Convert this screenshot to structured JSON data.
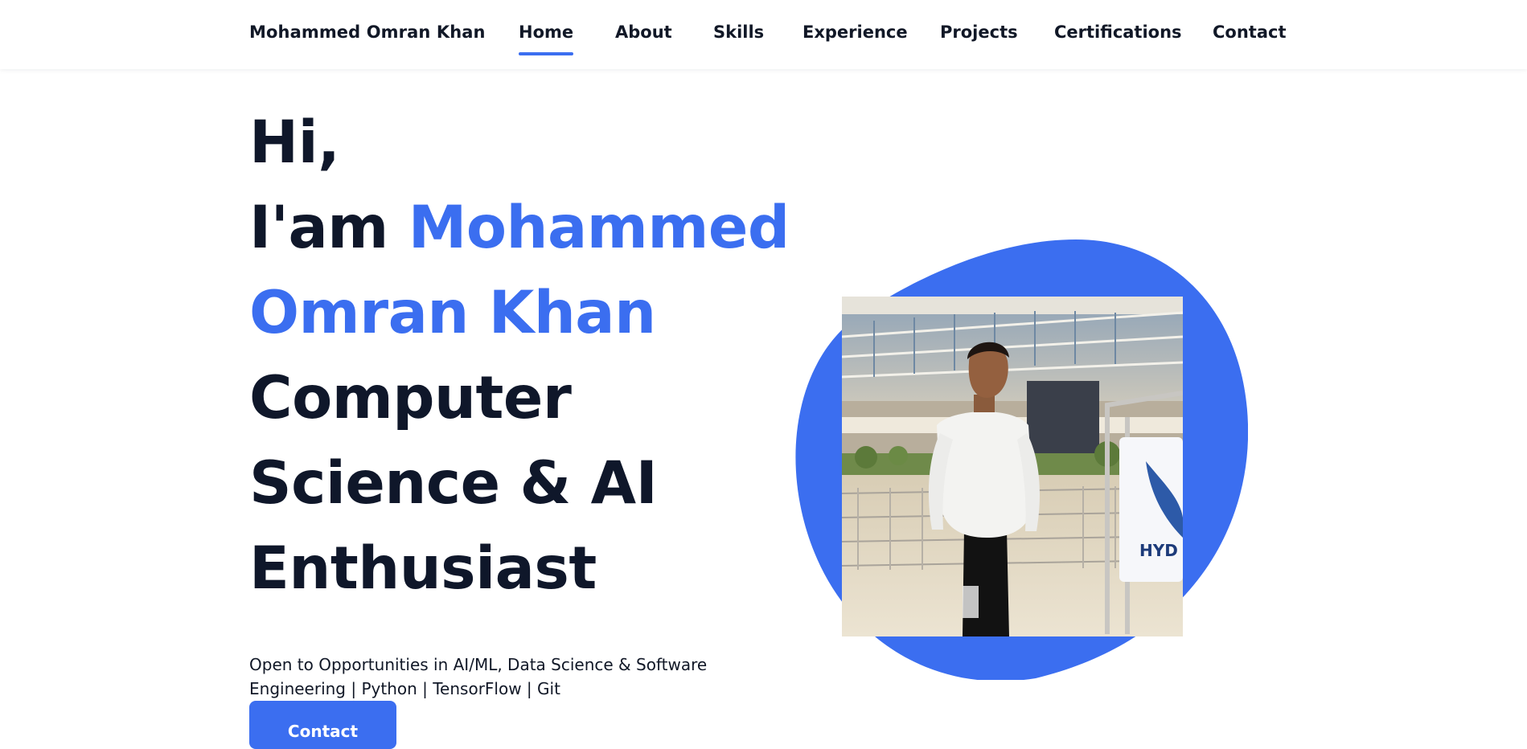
{
  "header": {
    "brand": "Mohammed Omran Khan",
    "nav": [
      {
        "label": "Home",
        "active": true
      },
      {
        "label": "About",
        "active": false
      },
      {
        "label": "Skills",
        "active": false
      },
      {
        "label": "Experience",
        "active": false
      },
      {
        "label": "Projects",
        "active": false
      },
      {
        "label": "Certifications",
        "active": false
      },
      {
        "label": "Contact",
        "active": false
      }
    ]
  },
  "hero": {
    "greeting": "Hi,",
    "intro_prefix": "I'am",
    "name_line1": "Mohammed",
    "name_line2": "Omran Khan",
    "title_line1": "Computer",
    "title_line2": "Science & AI",
    "title_line3": "Enthusiast",
    "tagline": "Open to Opportunities in AI/ML, Data Science & Software Engineering | Python | TensorFlow | Git",
    "contact_button": "Contact"
  },
  "photo": {
    "signage_text": "HYD"
  },
  "colors": {
    "accent": "#3b6ef0",
    "heading": "#0f172a",
    "text": "#111827",
    "background": "#ffffff"
  }
}
